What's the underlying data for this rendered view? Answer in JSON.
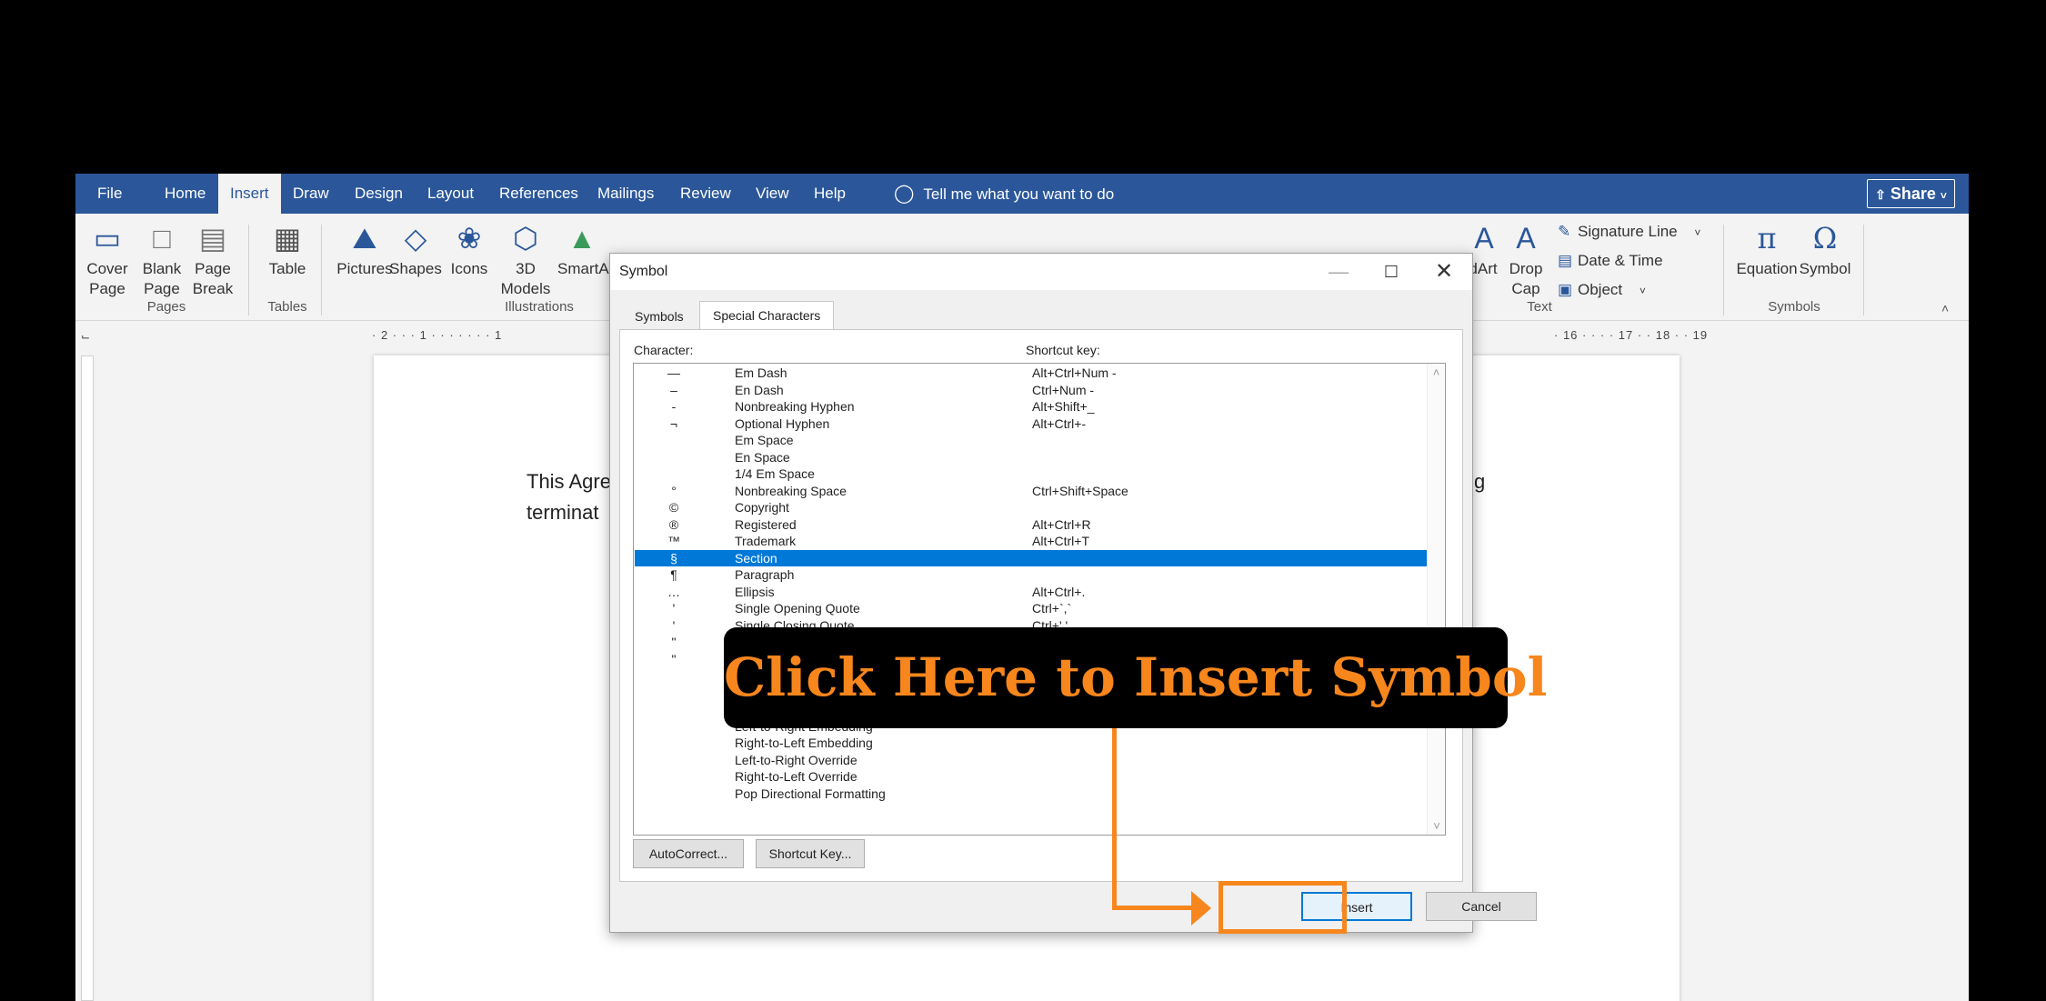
{
  "menubar": {
    "file": "File",
    "tabs": [
      "Home",
      "Insert",
      "Draw",
      "Design",
      "Layout",
      "References",
      "Mailings",
      "Review",
      "View",
      "Help"
    ],
    "tell_me": "Tell me what you want to do",
    "share": "Share"
  },
  "ribbon": {
    "pages": {
      "cover": "Cover",
      "cover2": "Page",
      "blank": "Blank",
      "blank2": "Page",
      "break": "Page",
      "break2": "Break",
      "label": "Pages"
    },
    "tables": {
      "table": "Table",
      "label": "Tables"
    },
    "illustrations": {
      "pictures": "Pictures",
      "shapes": "Shapes",
      "icons": "Icons",
      "models": "3D",
      "models2": "Models",
      "smartart": "SmartA",
      "label": "Illustrations"
    },
    "text": {
      "wordart": "dArt",
      "dropcap": "Drop",
      "dropcap2": "Cap",
      "signature": "Signature Line",
      "datetime": "Date & Time",
      "object": "Object",
      "label": "Text"
    },
    "symbols": {
      "equation": "Equation",
      "symbol": "Symbol",
      "label": "Symbols"
    }
  },
  "ruler": {
    "left": "· 2 · · · 1 · · · ·   · · · 1",
    "right": "· 16 · · · · 17 · · 18 · · 19"
  },
  "document": {
    "line1_start": "This Agre",
    "line1_end": "g",
    "line2_start": "terminat"
  },
  "dialog": {
    "title": "Symbol",
    "tabs": [
      "Symbols",
      "Special Characters"
    ],
    "character_label": "Character:",
    "shortcut_label": "Shortcut key:",
    "rows": [
      {
        "char": "—",
        "name": "Em Dash",
        "shortcut": "Alt+Ctrl+Num -"
      },
      {
        "char": "–",
        "name": "En Dash",
        "shortcut": "Ctrl+Num -"
      },
      {
        "char": "-",
        "name": "Nonbreaking Hyphen",
        "shortcut": "Alt+Shift+_"
      },
      {
        "char": "¬",
        "name": "Optional Hyphen",
        "shortcut": "Alt+Ctrl+-"
      },
      {
        "char": "",
        "name": "Em Space",
        "shortcut": ""
      },
      {
        "char": "",
        "name": "En Space",
        "shortcut": ""
      },
      {
        "char": "",
        "name": "1/4 Em Space",
        "shortcut": ""
      },
      {
        "char": "°",
        "name": "Nonbreaking Space",
        "shortcut": "Ctrl+Shift+Space"
      },
      {
        "char": "©",
        "name": "Copyright",
        "shortcut": ""
      },
      {
        "char": "®",
        "name": "Registered",
        "shortcut": "Alt+Ctrl+R"
      },
      {
        "char": "™",
        "name": "Trademark",
        "shortcut": "Alt+Ctrl+T"
      },
      {
        "char": "§",
        "name": "Section",
        "shortcut": ""
      },
      {
        "char": "¶",
        "name": "Paragraph",
        "shortcut": ""
      },
      {
        "char": "…",
        "name": "Ellipsis",
        "shortcut": "Alt+Ctrl+."
      },
      {
        "char": "'",
        "name": "Single Opening Quote",
        "shortcut": "Ctrl+`,`"
      },
      {
        "char": "'",
        "name": "Single Closing Quote",
        "shortcut": "Ctrl+','"
      },
      {
        "char": "\"",
        "name": "",
        "shortcut": ""
      },
      {
        "char": "\"",
        "name": "",
        "shortcut": ""
      },
      {
        "char": "",
        "name": "",
        "shortcut": ""
      },
      {
        "char": "",
        "name": "",
        "shortcut": ""
      },
      {
        "char": "",
        "name": "",
        "shortcut": ""
      },
      {
        "char": "",
        "name": "Left-to-Right Embedding",
        "shortcut": ""
      },
      {
        "char": "",
        "name": "Right-to-Left Embedding",
        "shortcut": ""
      },
      {
        "char": "",
        "name": "Left-to-Right Override",
        "shortcut": ""
      },
      {
        "char": "",
        "name": "Right-to-Left Override",
        "shortcut": ""
      },
      {
        "char": "",
        "name": "Pop Directional Formatting",
        "shortcut": ""
      }
    ],
    "selected_index": 11,
    "autocorrect": "AutoCorrect...",
    "shortcut_key": "Shortcut Key...",
    "insert": "Insert",
    "cancel": "Cancel"
  },
  "overlay": {
    "callout": "Click Here to Insert Symbol",
    "accent": "#f7861d"
  }
}
